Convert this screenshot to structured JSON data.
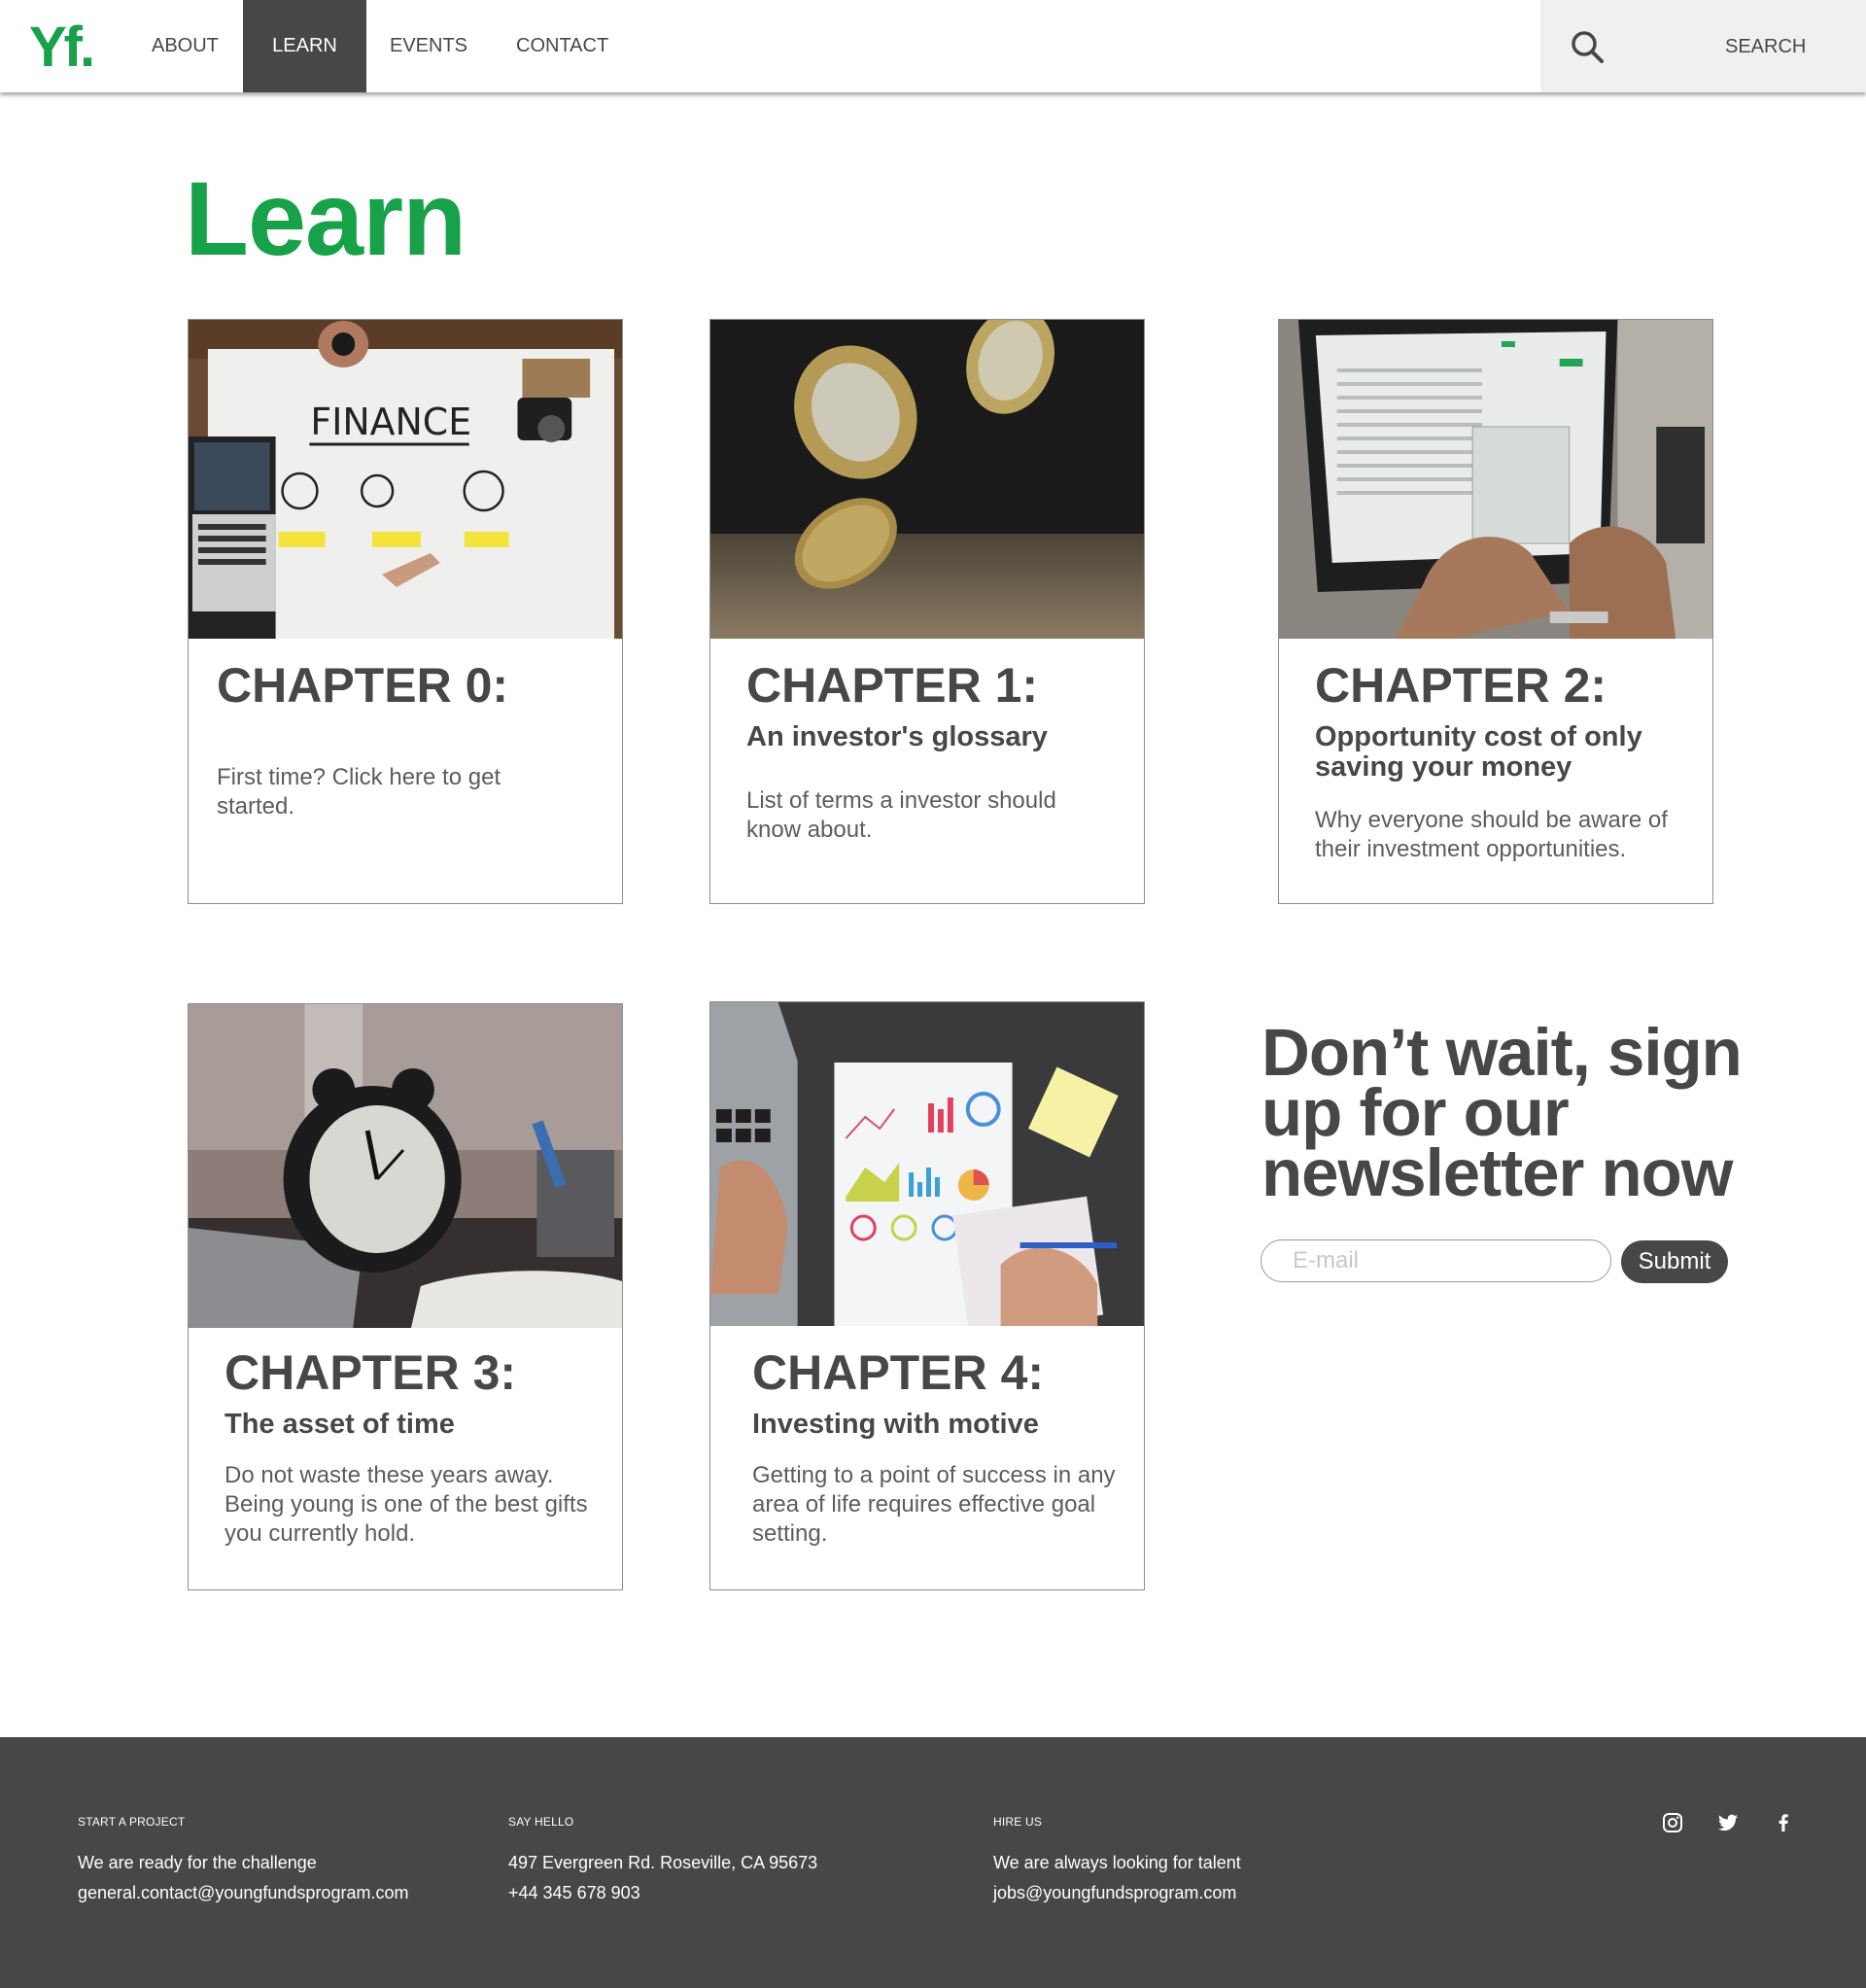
{
  "brand": {
    "logo_text": "Yf.",
    "accent_color": "#17a24a",
    "dark_color": "#474747"
  },
  "nav": {
    "items": [
      {
        "label": "ABOUT",
        "active": false
      },
      {
        "label": "LEARN",
        "active": true
      },
      {
        "label": "EVENTS",
        "active": false
      },
      {
        "label": "CONTACT",
        "active": false
      }
    ],
    "search": {
      "icon": "search-icon",
      "label": "SEARCH"
    }
  },
  "page": {
    "title": "Learn"
  },
  "chapters": [
    {
      "heading": "CHAPTER 0:",
      "subtitle": "",
      "description": "First time? Click here to get started.",
      "image": "finance-sketch-photo"
    },
    {
      "heading": "CHAPTER 1:",
      "subtitle": "An investor's glossary",
      "description": "List of terms a investor should know about.",
      "image": "falling-coins-photo"
    },
    {
      "heading": "CHAPTER 2:",
      "subtitle": "Opportunity cost of only saving your money",
      "description": "Why everyone should be aware of their investment opportunities.",
      "image": "laptop-typing-photo"
    },
    {
      "heading": "CHAPTER 3:",
      "subtitle": "The asset of time",
      "description": "Do not waste these years away. Being young is one of the best gifts you currently hold.",
      "image": "alarm-clock-photo"
    },
    {
      "heading": "CHAPTER 4:",
      "subtitle": "Investing with motive",
      "description": "Getting to a point of success in any area of life requires effective goal setting.",
      "image": "charts-desk-photo"
    }
  ],
  "newsletter": {
    "title": "Don’t wait, sign up for our newsletter now",
    "email_placeholder": "E-mail",
    "email_value": "",
    "submit_label": "Submit"
  },
  "footer": {
    "columns": [
      {
        "heading": "START A PROJECT",
        "lines": [
          "We are ready for the challenge",
          "general.contact@youngfundsprogram.com"
        ]
      },
      {
        "heading": "SAY HELLO",
        "lines": [
          "497 Evergreen Rd. Roseville, CA 95673",
          "+44 345 678 903"
        ]
      },
      {
        "heading": "HIRE US",
        "lines": [
          "We are always looking for talent",
          "jobs@youngfundsprogram.com"
        ]
      }
    ],
    "social": [
      "instagram-icon",
      "twitter-icon",
      "facebook-icon"
    ]
  }
}
